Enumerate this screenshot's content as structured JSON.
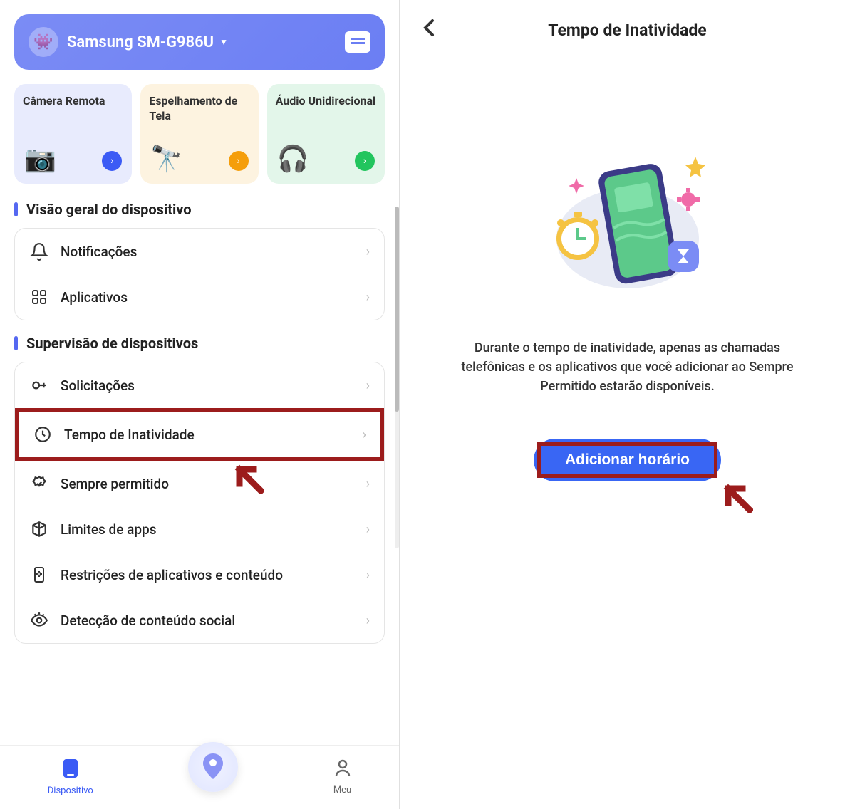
{
  "left": {
    "device_name": "Samsung SM-G986U",
    "features": [
      {
        "title": "Câmera Remota",
        "icon": "📷",
        "tint": "purple",
        "arrow": "blue"
      },
      {
        "title": "Espelhamento de Tela",
        "icon": "🔭",
        "tint": "orange",
        "arrow": "org"
      },
      {
        "title": "Áudio Unidirecional",
        "icon": "🎧",
        "tint": "green",
        "arrow": "grn"
      }
    ],
    "section_overview": {
      "title": "Visão geral do dispositivo",
      "items": [
        {
          "label": "Notificações",
          "icon": "bell"
        },
        {
          "label": "Aplicativos",
          "icon": "apps"
        }
      ]
    },
    "section_supervision": {
      "title": "Supervisão de dispositivos",
      "items": [
        {
          "label": "Solicitações",
          "icon": "key"
        },
        {
          "label": "Tempo de Inatividade",
          "icon": "clock",
          "highlighted": true
        },
        {
          "label": "Sempre permitido",
          "icon": "shield"
        },
        {
          "label": "Limites de apps",
          "icon": "cube"
        },
        {
          "label": "Restrições de aplicativos e conteúdo",
          "icon": "phone-cog"
        },
        {
          "label": "Detecção de conteúdo social",
          "icon": "eye"
        }
      ]
    },
    "bottom_nav": {
      "device_label": "Dispositivo",
      "user_label": "Meu"
    }
  },
  "right": {
    "title": "Tempo de Inatividade",
    "description": "Durante o tempo de inatividade, apenas as chamadas telefônicas e os aplicativos que você adicionar ao Sempre Permitido estarão disponíveis.",
    "button_label": "Adicionar horário"
  }
}
